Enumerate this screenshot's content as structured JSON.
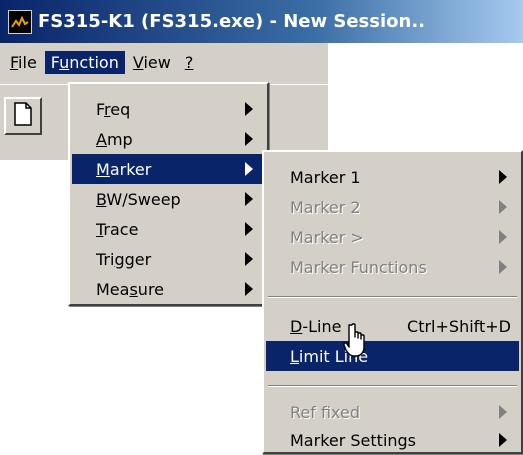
{
  "titlebar": {
    "title": "FS315-K1 (FS315.exe) - New Session..",
    "icon": "waveform-icon"
  },
  "menubar": {
    "items": [
      {
        "pre": "",
        "u": "F",
        "post": "ile"
      },
      {
        "pre": "F",
        "u": "u",
        "post": "nction"
      },
      {
        "pre": "",
        "u": "V",
        "post": "iew"
      },
      {
        "pre": "",
        "u": "?",
        "post": ""
      }
    ]
  },
  "function_menu": {
    "items": [
      {
        "pre": "F",
        "u": "r",
        "post": "eq"
      },
      {
        "pre": "",
        "u": "A",
        "post": "mp"
      },
      {
        "pre": "",
        "u": "M",
        "post": "arker"
      },
      {
        "pre": "",
        "u": "B",
        "post": "W/Sweep"
      },
      {
        "pre": "",
        "u": "T",
        "post": "race"
      },
      {
        "pre": "Tri",
        "u": "g",
        "post": "ger"
      },
      {
        "pre": "Mea",
        "u": "s",
        "post": "ure"
      }
    ]
  },
  "marker_menu": {
    "items": [
      {
        "label": "Marker 1"
      },
      {
        "label": "Marker 2"
      },
      {
        "label": "Marker >"
      },
      {
        "label": "Marker Functions"
      },
      {
        "pre": "",
        "u": "D",
        "post": "-Line",
        "accel": "Ctrl+Shift+D"
      },
      {
        "pre": "",
        "u": "L",
        "post": "imit Line"
      },
      {
        "label": "Ref fixed"
      },
      {
        "label": "Marker Settings"
      }
    ]
  },
  "colors": {
    "highlight": "#0a246a",
    "face": "#d4d0c8"
  },
  "cursor": "hand-pointer-icon"
}
